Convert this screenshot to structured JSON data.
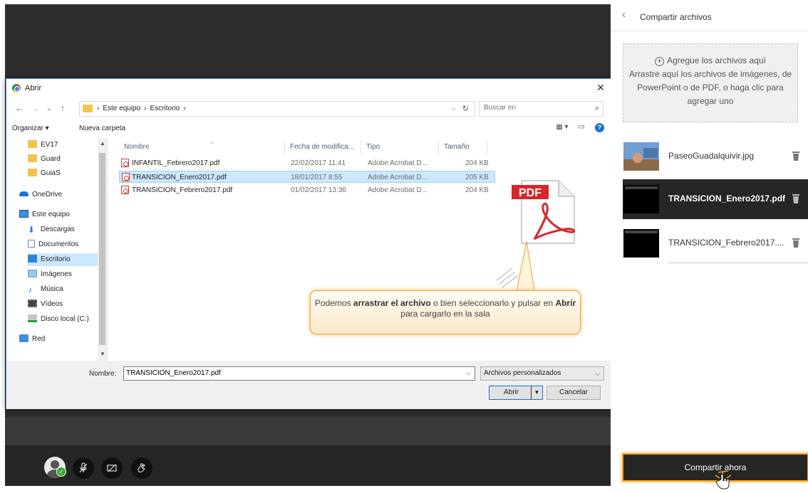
{
  "dialog": {
    "title": "Abrir",
    "breadcrumb": [
      "Este equipo",
      "Escritorio"
    ],
    "search_placeholder": "Buscar en",
    "toolbar": {
      "organize": "Organizar ▾",
      "new_folder": "Nueva carpeta"
    },
    "nav_items": [
      {
        "label": "EV17",
        "icon": "folder-icon"
      },
      {
        "label": "Guard",
        "icon": "folder-icon"
      },
      {
        "label": "GuiaS",
        "icon": "folder-icon"
      },
      {
        "label": "OneDrive",
        "icon": "cloud-icon"
      },
      {
        "label": "Este equipo",
        "icon": "computer-icon"
      },
      {
        "label": "Descargas",
        "icon": "download-icon"
      },
      {
        "label": "Documentos",
        "icon": "documents-icon"
      },
      {
        "label": "Escritorio",
        "icon": "desktop-icon"
      },
      {
        "label": "Imágenes",
        "icon": "pictures-icon"
      },
      {
        "label": "Música",
        "icon": "music-icon"
      },
      {
        "label": "Vídeos",
        "icon": "videos-icon"
      },
      {
        "label": "Disco local (C:)",
        "icon": "disk-icon"
      },
      {
        "label": "Red",
        "icon": "network-icon"
      }
    ],
    "columns": [
      "Nombre",
      "Fecha de modifica...",
      "Tipo",
      "Tamaño"
    ],
    "files": [
      {
        "name": "INFANTIL_Febrero2017.pdf",
        "date": "22/02/2017 11:41",
        "type": "Adobe Acrobat D...",
        "size": "204 KB",
        "selected": false
      },
      {
        "name": "TRANSICION_Enero2017.pdf",
        "date": "18/01/2017 8:55",
        "type": "Adobe Acrobat D...",
        "size": "205 KB",
        "selected": true
      },
      {
        "name": "TRANSICION_Febrero2017.pdf",
        "date": "01/02/2017 13:36",
        "type": "Adobe Acrobat D...",
        "size": "204 KB",
        "selected": false
      }
    ],
    "pdf_badge": "PDF",
    "filename_label": "Nombre:",
    "filename_value": "TRANSICION_Enero2017.pdf",
    "filetype_value": "Archivos personalizados",
    "open_label": "Abrir",
    "cancel_label": "Cancelar",
    "callout": {
      "p1": "Podemos ",
      "b1": "arrastrar el archivo",
      "p2": " o bien seleccionarlo y pulsar en ",
      "b2": "Abrir",
      "p3": " para cargarlo en la sala"
    }
  },
  "panel": {
    "title": "Compartir archivos",
    "dropzone_title": "Agregue los archivos aquí",
    "dropzone_text": "Arrastre aquí los archivos de imágenes, de PowerPoint o de PDF, o haga clic para agregar uno",
    "files": [
      {
        "name": "PaseoGuadalquivir.jpg",
        "selected": false
      },
      {
        "name": "TRANSICION_Enero2017.pdf",
        "selected": true
      },
      {
        "name": "TRANSICION_Febrero2017....",
        "selected": false
      }
    ],
    "share_label": "Compartir ahora"
  },
  "colors": {
    "accent": "#f2a31c",
    "selection": "#cce8ff",
    "dark": "#262626"
  }
}
